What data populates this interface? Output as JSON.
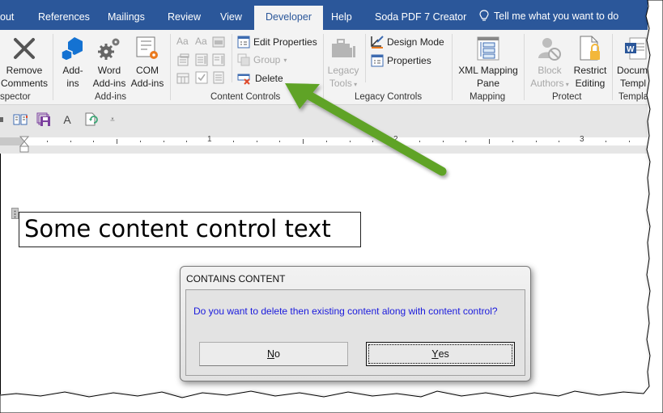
{
  "tabs": [
    {
      "label": "out",
      "active": false
    },
    {
      "label": "References",
      "active": false
    },
    {
      "label": "Mailings",
      "active": false
    },
    {
      "label": "Review",
      "active": false
    },
    {
      "label": "View",
      "active": false
    },
    {
      "label": "Developer",
      "active": true
    },
    {
      "label": "Help",
      "active": false
    },
    {
      "label": "Soda PDF 7 Creator",
      "active": false
    }
  ],
  "tell_me": "Tell me what you want to do",
  "ribbon": {
    "inspector": {
      "label": "spector",
      "remove_comments": [
        "Remove",
        "Comments"
      ]
    },
    "addins": {
      "label": "Add-ins",
      "addins_btn": [
        "Add-",
        "ins"
      ],
      "word_addins": [
        "Word",
        "Add-ins"
      ],
      "com_addins": [
        "COM",
        "Add-ins"
      ]
    },
    "content_controls": {
      "label": "Content Controls",
      "edit_properties": "Edit Properties",
      "group": "Group",
      "delete": "Delete"
    },
    "legacy_controls": {
      "label": "Legacy Controls",
      "legacy_tools": [
        "Legacy",
        "Tools"
      ],
      "design_mode": "Design Mode",
      "properties": "Properties"
    },
    "mapping": {
      "label": "Mapping",
      "xml_mapping": [
        "XML Mapping",
        "Pane"
      ]
    },
    "protect": {
      "label": "Protect",
      "block_authors": [
        "Block",
        "Authors"
      ],
      "restrict_editing": [
        "Restrict",
        "Editing"
      ]
    },
    "templates": {
      "label": "Templa",
      "document_template": [
        "Docum",
        "Templ"
      ]
    }
  },
  "ruler": {
    "numbers": [
      "1",
      "2",
      "3"
    ]
  },
  "document": {
    "content_control_text": "Some content control text"
  },
  "dialog": {
    "title": "CONTAINS CONTENT",
    "message": "Do you want to delete then existing content along with content control?",
    "no_label_u": "N",
    "no_label_rest": "o",
    "yes_label_u": "Y",
    "yes_label_rest": "es"
  },
  "colors": {
    "ribbon_blue": "#2b579a",
    "annotation_arrow": "#5ea328",
    "dialog_text": "#1a1adc"
  }
}
